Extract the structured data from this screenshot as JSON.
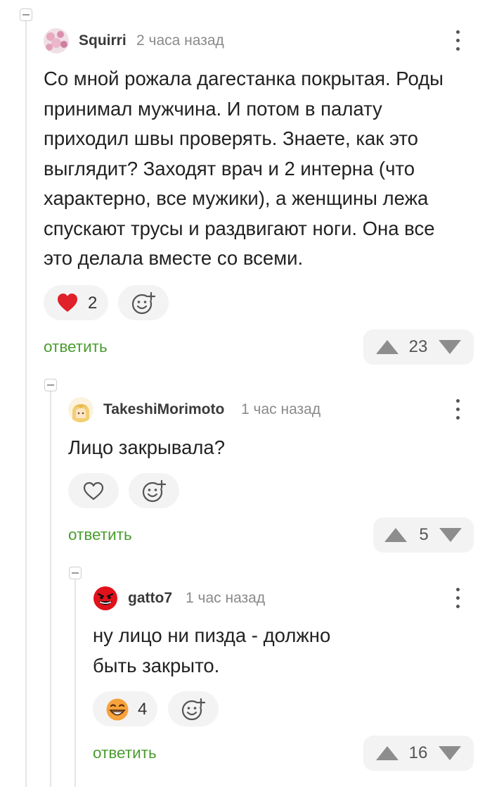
{
  "comments": [
    {
      "username": "Squirri",
      "time": "2 часа назад",
      "text_lines": [
        "Со мной рожала дагестанка покрытая. Роды",
        "принимал мужчина. И потом в палату",
        "приходил швы проверять. Знаете, как это",
        "выглядит? Заходят врач и 2 интерна (что",
        "характерно, все мужики), а женщины лежа",
        "спускают трусы и раздвигают ноги. Она все",
        "это делала вместе со всеми."
      ],
      "reaction_icon": "heart-icon",
      "reaction_count": "2",
      "reply_label": "ответить",
      "rating": "23"
    },
    {
      "username": "TakeshiMorimoto",
      "time": "1 час назад",
      "text_lines": [
        "Лицо закрывала?"
      ],
      "reaction_icon": "heart-outline-icon",
      "reply_label": "ответить",
      "rating": "5"
    },
    {
      "username": "gatto7",
      "time": "1 час назад",
      "text_lines": [
        "ну лицо ни пизда - должно",
        "быть закрыто."
      ],
      "reaction_icon": "grinning-face-icon",
      "reaction_count": "4",
      "reply_label": "ответить",
      "rating": "16"
    }
  ],
  "colors": {
    "reply_green": "#4a9c2f",
    "heart_red": "#e0202a",
    "pill_bg": "#f3f3f4",
    "thread_line": "#e6e6e6"
  }
}
